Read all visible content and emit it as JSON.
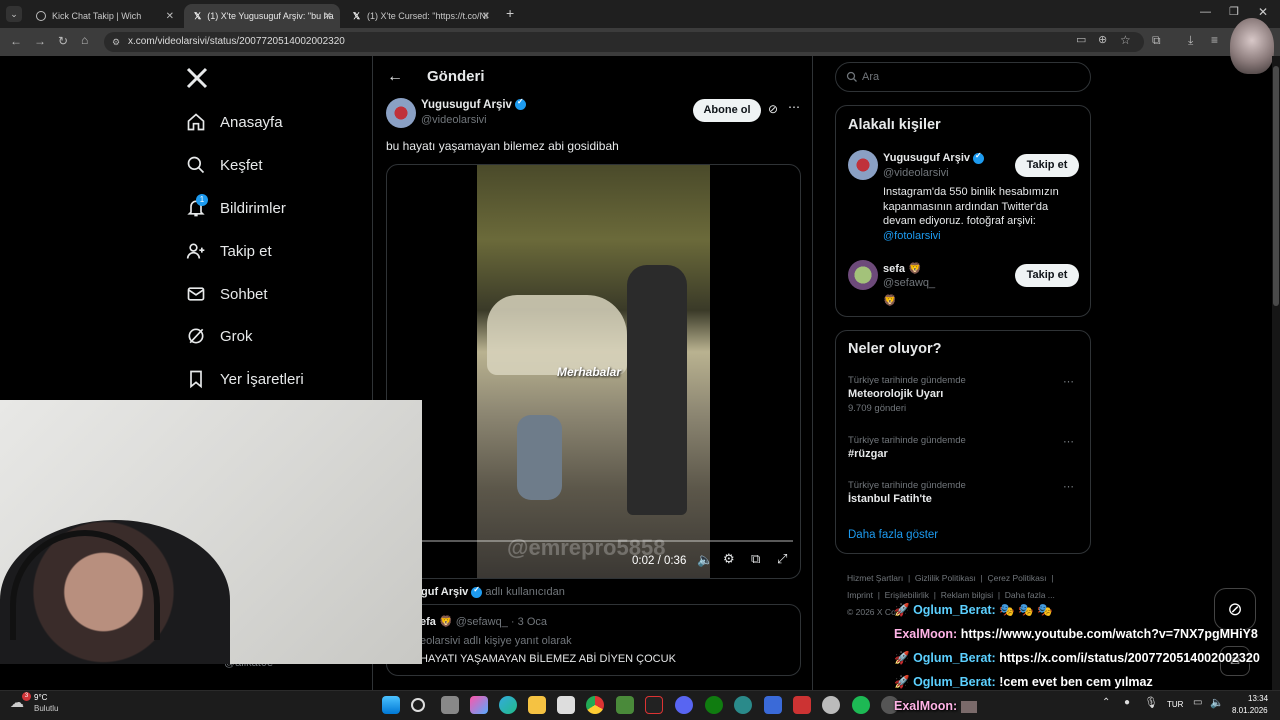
{
  "browser": {
    "tabs": [
      {
        "title": "Kick Chat Takip | Wich",
        "active": false
      },
      {
        "title": "(1) X'te Yugusuguf Arşiv: \"bu ha",
        "active": true
      },
      {
        "title": "(1) X'te Cursed: \"https://t.co/Nl",
        "active": false
      }
    ],
    "new_tab": "+",
    "url": "x.com/videolarsivi/status/2007720514002002320"
  },
  "nav": {
    "logo": "X",
    "items": [
      {
        "label": "Anasayfa",
        "icon": "home-icon"
      },
      {
        "label": "Keşfet",
        "icon": "search-icon"
      },
      {
        "label": "Bildirimler",
        "icon": "bell-icon",
        "badge": "1"
      },
      {
        "label": "Takip et",
        "icon": "follow-icon"
      },
      {
        "label": "Sohbet",
        "icon": "mail-icon"
      },
      {
        "label": "Grok",
        "icon": "grok-icon"
      },
      {
        "label": "Yer İşaretleri",
        "icon": "bookmark-icon"
      }
    ],
    "partial_handle": "@alikat0e"
  },
  "post": {
    "header_title": "Gönderi",
    "author": "Yugusuguf Arşiv",
    "handle": "@videolarsivi",
    "subscribe": "Abone ol",
    "text": "bu hayatı yaşamayan bilemez abi gosidibah",
    "video": {
      "overlay_text": "Merhabalar",
      "watermark": "@emrepro5858",
      "time": "0:02 / 0:36",
      "progress": 0.055
    },
    "from_user_name": "guf Arşiv",
    "from_user_suffix": "adlı kullanıcıdan",
    "reply": {
      "name": "efa 🦁",
      "handle": "@sefawq_",
      "date": "· 3 Oca",
      "reply_to": "eolarsivi adlı kişiye yanıt olarak",
      "text": "HAYATI YAŞAMAYAN BİLEMEZ ABİ DİYEN ÇOCUK"
    }
  },
  "right": {
    "search_placeholder": "Ara",
    "related_title": "Alakalı kişiler",
    "people": [
      {
        "name": "Yugusuguf Arşiv",
        "handle": "@videolarsivi",
        "button": "Takip et",
        "bio": "Instagram'da 550 binlik hesabımızın kapanmasının ardından Twitter'da devam ediyoruz. fotoğraf arşivi:",
        "bio_link": "@fotolarsivi"
      },
      {
        "name": "sefa 🦁",
        "handle": "@sefawq_",
        "button": "Takip et",
        "bio": "🦁"
      }
    ],
    "trends_title": "Neler oluyor?",
    "trends": [
      {
        "context": "Türkiye tarihinde gündemde",
        "name": "Meteorolojik Uyarı",
        "count": "9.709 gönderi"
      },
      {
        "context": "Türkiye tarihinde gündemde",
        "name": "#rüzgar",
        "count": ""
      },
      {
        "context": "Türkiye tarihinde gündemde",
        "name": "İstanbul Fatih'te",
        "count": ""
      }
    ],
    "show_more": "Daha fazla göster",
    "footer": [
      "Hizmet Şartları",
      "Gizlilik Politikası",
      "Çerez Politikası",
      "Imprint",
      "Erişilebilirlik",
      "Reklam bilgisi",
      "Daha fazla ...",
      "© 2026 X Co"
    ]
  },
  "chat": [
    {
      "user": "Oglum_Berat:",
      "msg": "🎭 🎭 🎭",
      "color": "#5cd0ff"
    },
    {
      "user": "ExalMoon:",
      "msg": "https://www.youtube.com/watch?v=7NX7pgMHiY8",
      "color": "#ffb3e6"
    },
    {
      "user": "Oglum_Berat:",
      "msg": "https://x.com/i/status/2007720514002002320",
      "color": "#5cd0ff"
    },
    {
      "user": "Oglum_Berat:",
      "msg": "!cem evet ben cem yılmaz",
      "color": "#5cd0ff"
    },
    {
      "user": "ExalMoon:",
      "msg": "",
      "color": "#ffb3e6"
    }
  ],
  "taskbar": {
    "weather_temp": "9°C",
    "weather_desc": "Bulutlu",
    "weather_badge": "3",
    "lang": "TUR",
    "time": "13:34",
    "date": "8.01.2026"
  }
}
